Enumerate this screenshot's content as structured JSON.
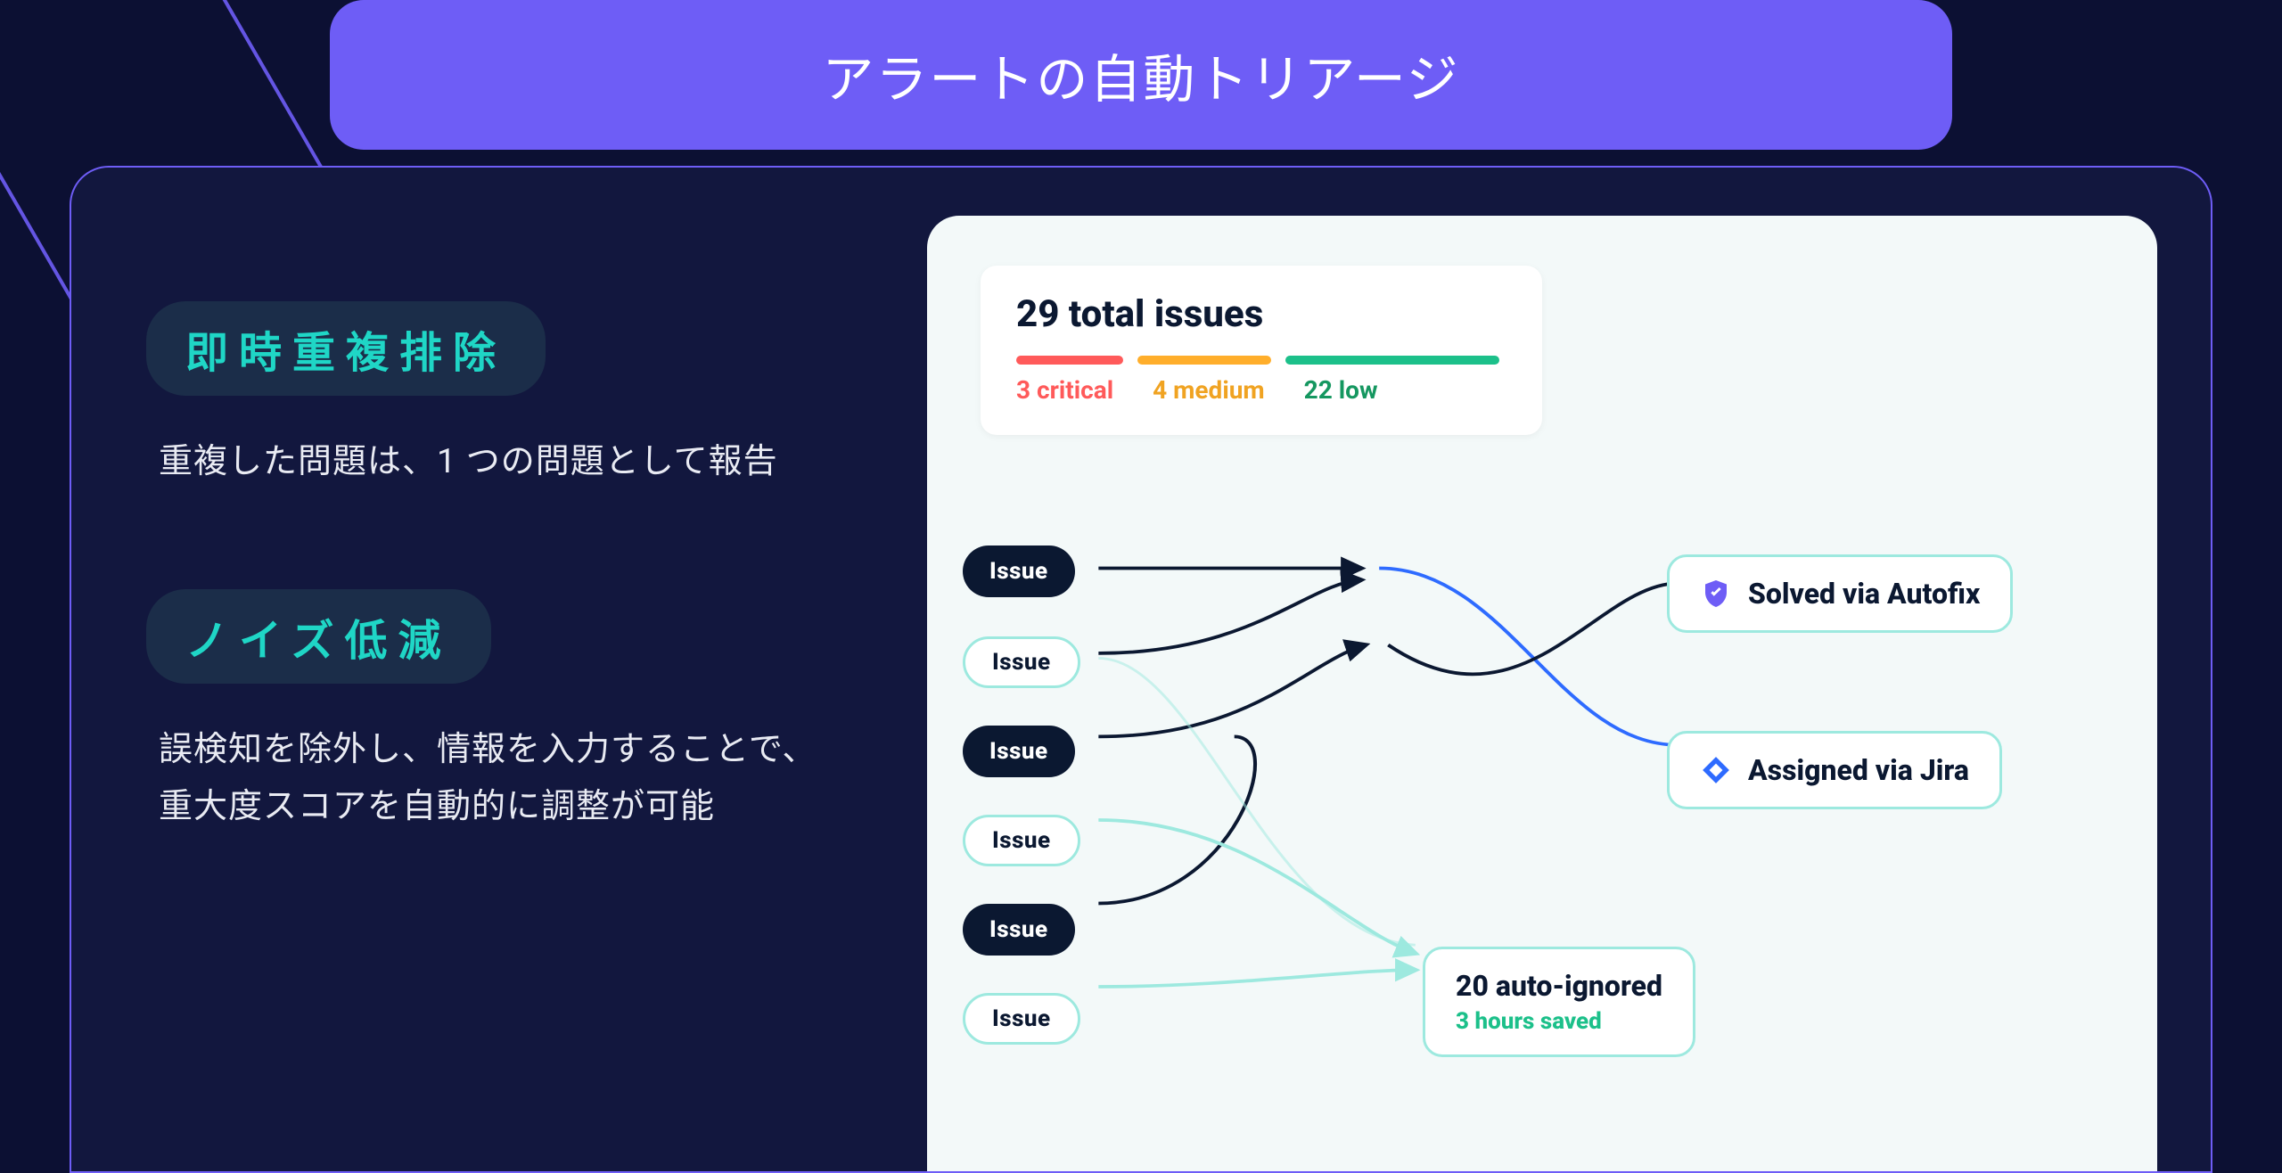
{
  "title": "アラートの自動トリアージ",
  "sections": [
    {
      "title": "即時重複排除",
      "body": "重複した問題は、1 つの問題として報告"
    },
    {
      "title": "ノイズ低減",
      "body": "誤検知を除外し、情報を入力することで、\n重大度スコアを自動的に調整が可能"
    }
  ],
  "summary": {
    "total_label": "29 total issues",
    "critical": "3 critical",
    "medium": "4 medium",
    "low": "22 low"
  },
  "issue_label": "Issue",
  "issues": [
    {
      "variant": "dark"
    },
    {
      "variant": "outline"
    },
    {
      "variant": "dark"
    },
    {
      "variant": "outline"
    },
    {
      "variant": "dark"
    },
    {
      "variant": "outline"
    }
  ],
  "results": {
    "autofix": "Solved via Autofix",
    "jira": "Assigned via Jira",
    "auto_ignored": "20 auto-ignored",
    "hours_saved": "3 hours saved"
  },
  "colors": {
    "purple": "#6e5df6",
    "teal": "#1fd6c6",
    "dark": "#0b1831",
    "blue": "#2e6bff"
  }
}
